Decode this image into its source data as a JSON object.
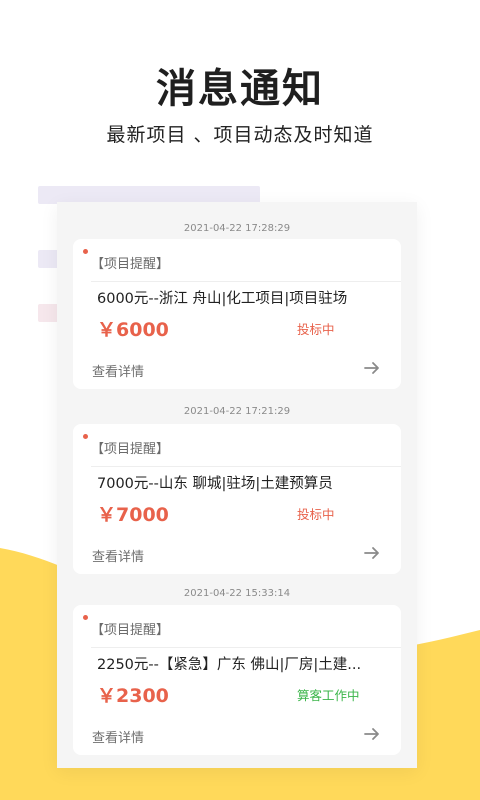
{
  "header": {
    "title": "消息通知",
    "subtitle": "最新项目 、项目动态及时知道"
  },
  "notifications": [
    {
      "timestamp": "2021-04-22 17:28:29",
      "tag": "【项目提醒】",
      "description": "6000元--浙江 舟山|化工项目|项目驻场",
      "price": "￥6000",
      "status": "投标中",
      "status_color": "#e8624b",
      "link_label": "查看详情"
    },
    {
      "timestamp": "2021-04-22 17:21:29",
      "tag": "【项目提醒】",
      "description": "7000元--山东 聊城|驻场|土建预算员",
      "price": "￥7000",
      "status": "投标中",
      "status_color": "#e8624b",
      "link_label": "查看详情"
    },
    {
      "timestamp": "2021-04-22 15:33:14",
      "tag": "【项目提醒】",
      "description": "2250元--【紧急】广东 佛山|厂房|土建...",
      "price": "￥2300",
      "status": "算客工作中",
      "status_color": "#3bb54a",
      "link_label": "查看详情"
    }
  ],
  "colors": {
    "accent": "#e8624b",
    "wave": "#ffd95a",
    "success": "#3bb54a"
  }
}
